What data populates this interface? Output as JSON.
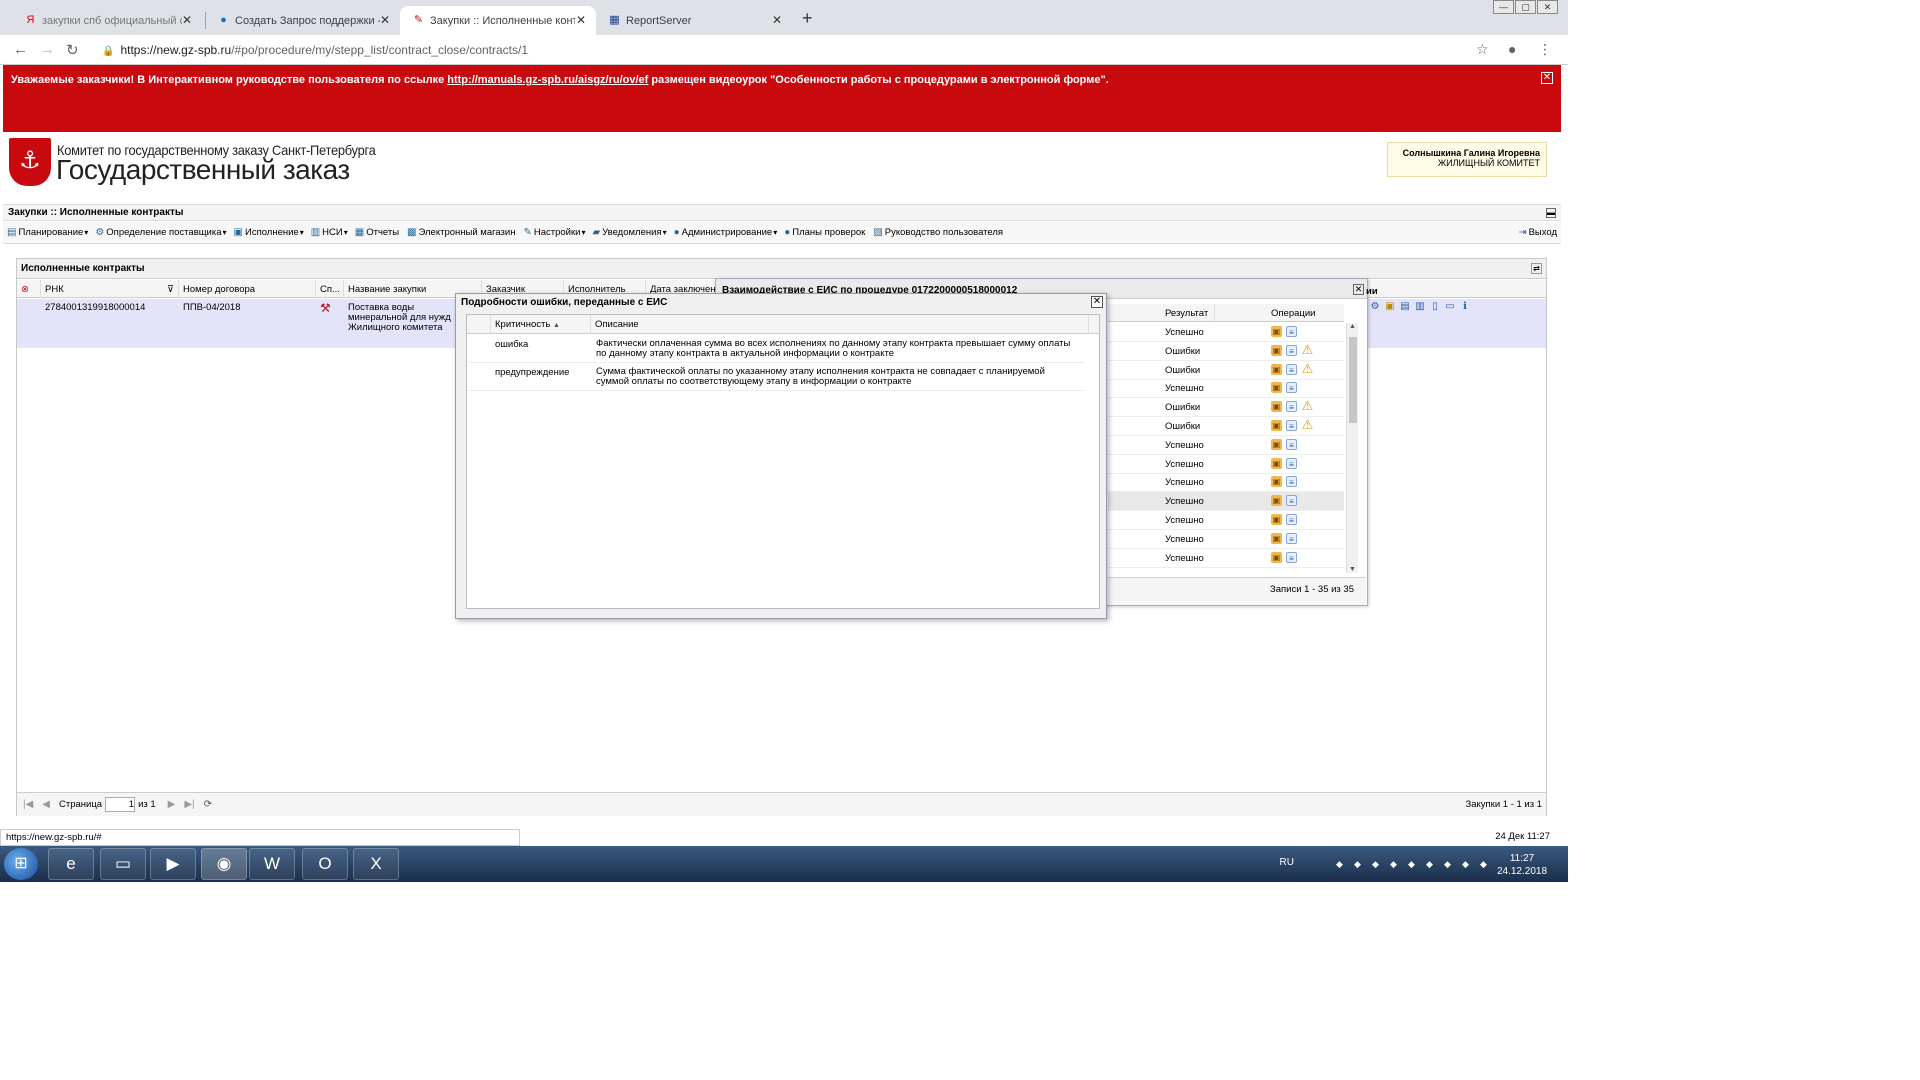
{
  "browser": {
    "tabs": [
      {
        "title": "закупки спб официальный сайт",
        "icon": "Я",
        "icon_color": "#e0001b"
      },
      {
        "title": "Создать Запрос поддержки - Al",
        "icon": "●",
        "icon_color": "#1a6fd1"
      },
      {
        "title": "Закупки :: Исполненные контра",
        "icon": "✎",
        "icon_color": "#c80a0f"
      },
      {
        "title": "ReportServer",
        "icon": "▦",
        "icon_color": "#1a3a8a"
      }
    ],
    "new_tab": "+",
    "url_host": "https://new.gz-spb.ru",
    "url_path": "/#po/procedure/my/stepp_list/contract_close/contracts/1"
  },
  "banner": {
    "text_before": "Уважаемые заказчики! В Интерактивном руководстве пользователя по ссылке ",
    "link": "http://manuals.gz-spb.ru/aisgz/ru/ov/ef",
    "text_after": " размещен видеоурок \"Особенности работы с процедурами в электронной форме\".",
    "close": "✕"
  },
  "header": {
    "org_line1": "Комитет по государственному заказу Санкт-Петербурга",
    "org_line2": "Государственный заказ",
    "user_name": "Солнышкина Галина Игоревна",
    "user_org": "ЖИЛИЩНЫЙ КОМИТЕТ"
  },
  "section_title": "Закупки :: Исполненные контракты",
  "menu": [
    {
      "label": "Планирование",
      "icon": "▤",
      "dropdown": "▾"
    },
    {
      "label": "Определение поставщика",
      "icon": "⚙",
      "dropdown": "▾"
    },
    {
      "label": "Исполнение",
      "icon": "▣",
      "dropdown": "▾"
    },
    {
      "label": "НСИ",
      "icon": "▥",
      "dropdown": "▾"
    },
    {
      "label": "Отчеты",
      "icon": "▦",
      "dropdown": ""
    },
    {
      "label": "Электронный магазин",
      "icon": "▩",
      "dropdown": ""
    },
    {
      "label": "Настройки",
      "icon": "✎",
      "dropdown": "▾"
    },
    {
      "label": "Уведомления",
      "icon": "▰",
      "dropdown": "▾"
    },
    {
      "label": "Администрирование",
      "icon": "●",
      "dropdown": "▾"
    },
    {
      "label": "Планы проверок",
      "icon": "●",
      "dropdown": ""
    },
    {
      "label": "Руководство пользователя",
      "icon": "▧",
      "dropdown": ""
    }
  ],
  "exit_label": "Выход",
  "main_panel": {
    "title": "Исполненные контракты",
    "columns": [
      "РНК",
      "Номер договора",
      "Сп...",
      "Название закупки",
      "Заказчик",
      "Исполнитель",
      "Дата заключен"
    ],
    "row": {
      "rnk": "2784001319918000014",
      "contract_no": "ППВ-04/2018",
      "name": "Поставка воды минеральной для нужд Жилищного комитета"
    },
    "pager": {
      "page_label": "Страница",
      "page_value": "1",
      "of_label": "из 1",
      "info": "Закупки 1 - 1 из 1"
    }
  },
  "back_dialog": {
    "title": "Взаимодействие с ЕИС по процедуре 0172200000518000012",
    "col_result": "Результат",
    "col_ops": "Операции",
    "trailing_col_fragment": "ии",
    "rows": [
      {
        "result": "Успешно",
        "warn": false
      },
      {
        "result": "Ошибки",
        "warn": true
      },
      {
        "result": "Ошибки",
        "warn": true
      },
      {
        "result": "Успешно",
        "warn": false
      },
      {
        "result": "Ошибки",
        "warn": true
      },
      {
        "result": "Ошибки",
        "warn": true
      },
      {
        "result": "Успешно",
        "warn": false
      },
      {
        "result": "Успешно",
        "warn": false
      },
      {
        "result": "Успешно",
        "warn": false
      },
      {
        "result": "Успешно",
        "warn": false
      },
      {
        "result": "Успешно",
        "warn": false
      },
      {
        "result": "Успешно",
        "warn": false
      },
      {
        "result": "Успешно",
        "warn": false
      }
    ],
    "footer": "Записи 1 - 35 из 35"
  },
  "front_dialog": {
    "title": "Подробности ошибки, переданные с ЕИС",
    "col_severity": "Критичность",
    "sort_indicator": "▲",
    "col_description": "Описание",
    "rows": [
      {
        "severity": "ошибка",
        "description": "Фактически оплаченная сумма во всех исполнениях по данному этапу контракта превышает сумму оплаты по данному этапу контракта в актуальной информации о контракте"
      },
      {
        "severity": "предупреждение",
        "description": "Сумма фактической оплаты по указанному этапу исполнения контракта не совпадает с планируемой суммой оплаты по соответствующему этапу в информации о контракте"
      }
    ]
  },
  "status": {
    "url_hint": "https://new.gz-spb.ru/#",
    "datetime": "24 Дек 11:27"
  },
  "taskbar": {
    "lang": "RU",
    "time": "11:27",
    "date": "24.12.2018"
  }
}
